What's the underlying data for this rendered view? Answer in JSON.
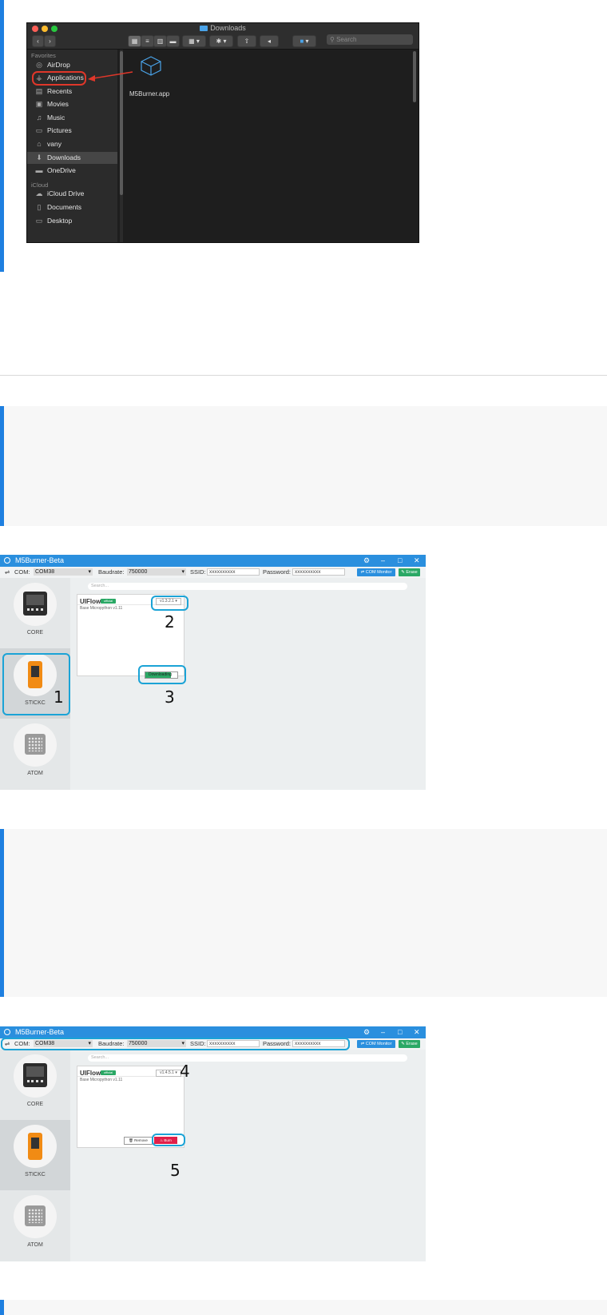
{
  "finder": {
    "window_title": "Downloads",
    "search_placeholder": "Search",
    "favorites_header": "Favorites",
    "icloud_header": "iCloud",
    "favorites": [
      {
        "label": "AirDrop",
        "icon": "airdrop-icon"
      },
      {
        "label": "Applications",
        "icon": "applications-icon"
      },
      {
        "label": "Recents",
        "icon": "recents-icon"
      },
      {
        "label": "Movies",
        "icon": "movies-icon"
      },
      {
        "label": "Music",
        "icon": "music-icon"
      },
      {
        "label": "Pictures",
        "icon": "pictures-icon"
      },
      {
        "label": "vany",
        "icon": "home-icon"
      },
      {
        "label": "Downloads",
        "icon": "downloads-icon",
        "selected": true
      },
      {
        "label": "OneDrive",
        "icon": "folder-icon"
      }
    ],
    "icloud": [
      {
        "label": "iCloud Drive",
        "icon": "cloud-icon"
      },
      {
        "label": "Documents",
        "icon": "documents-icon"
      },
      {
        "label": "Desktop",
        "icon": "desktop-icon"
      }
    ],
    "file": {
      "name": "M5Burner.app"
    }
  },
  "m5burner_1": {
    "app_title": "M5Burner-Beta",
    "com_label": "COM:",
    "com_value": "COM38",
    "baudrate_label": "Baudrate:",
    "baudrate_value": "750000",
    "ssid_label": "SSID:",
    "ssid_value": "xxxxxxxxxx",
    "password_label": "Password:",
    "password_value": "xxxxxxxxxx",
    "com_monitor_label": "COM Monitor",
    "erase_label": "Erase",
    "search_placeholder": "Search...",
    "devices": [
      "CORE",
      "STICKC",
      "ATOM"
    ],
    "selected_device": "STICKC",
    "firmware": {
      "name": "UIFlow",
      "badge": "official",
      "description": "Base Micropython v1.11",
      "version": "v1.3.2.1"
    },
    "download": {
      "label": "Downloading",
      "progress_percent": 80
    },
    "annotations": [
      "1",
      "2",
      "3"
    ]
  },
  "m5burner_2": {
    "app_title": "M5Burner-Beta",
    "com_label": "COM:",
    "com_value": "COM38",
    "baudrate_label": "Baudrate:",
    "baudrate_value": "750000",
    "ssid_label": "SSID:",
    "ssid_value": "xxxxxxxxxx",
    "password_label": "Password:",
    "password_value": "xxxxxxxxxx",
    "com_monitor_label": "COM Monitor",
    "erase_label": "Erase",
    "search_placeholder": "Search...",
    "devices": [
      "CORE",
      "STICKC",
      "ATOM"
    ],
    "selected_device": "STICKC",
    "firmware": {
      "name": "UIFlow",
      "badge": "official",
      "description": "Base Micropython v1.11",
      "version": "v1.4.5.1",
      "remove_label": "Remove",
      "burn_label": "Burn"
    },
    "annotations": [
      "4",
      "5"
    ]
  },
  "colors": {
    "accent_blue": "#1e7fe0",
    "m5_titlebar": "#2a8fde",
    "highlight_cyan": "#1ba3d6",
    "highlight_red": "#e0372a",
    "burn_red": "#e0204a",
    "ok_green": "#2aa865"
  }
}
